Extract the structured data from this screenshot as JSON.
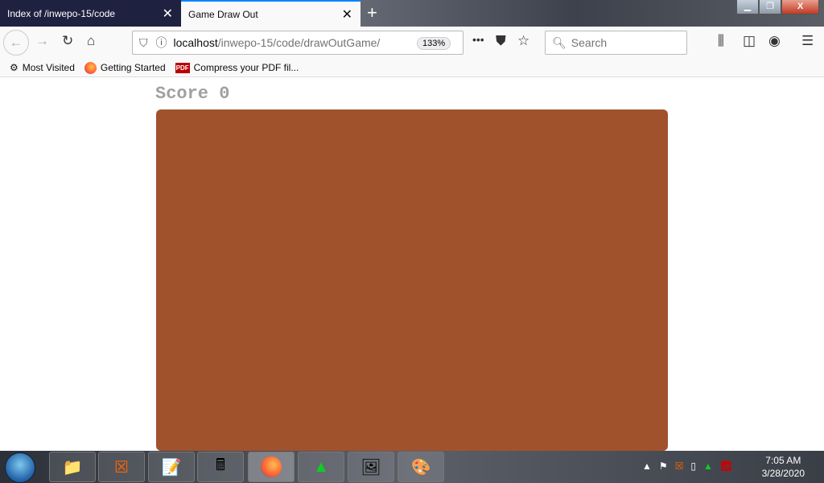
{
  "tabs": [
    {
      "title": "Index of /inwepo-15/code",
      "active": false
    },
    {
      "title": "Game Draw Out",
      "active": true
    }
  ],
  "url": {
    "host": "localhost",
    "path": "/inwepo-15/code/drawOutGame/",
    "zoom": "133%"
  },
  "search": {
    "placeholder": "Search"
  },
  "bookmarks": [
    "Most Visited",
    "Getting Started",
    "Compress your PDF fil..."
  ],
  "page": {
    "score_label": "Score",
    "score": "0",
    "canvas_color": "#a0522d"
  },
  "taskbar": {
    "time": "7:05 AM",
    "date": "3/28/2020"
  }
}
